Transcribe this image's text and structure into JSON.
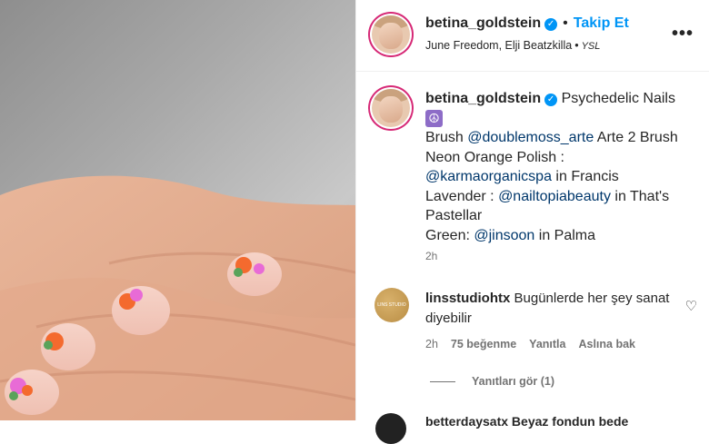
{
  "header": {
    "username": "betina_goldstein",
    "follow_label": "Takip Et",
    "audio": "June Freedom, Elji Beatzkilla",
    "brand": "YSL",
    "more_icon": "more-horizontal-icon"
  },
  "caption": {
    "username": "betina_goldstein",
    "title": "Psychedelic Nails",
    "emoji_icon": "peace-symbol-icon",
    "line1_a": "Brush ",
    "line1_mention": "@doublemoss_arte",
    "line1_b": " Arte 2 Brush",
    "line2": "Neon Orange Polish :",
    "line3_mention": "@karmaorganicspa",
    "line3_b": " in Francis",
    "line4_a": "Lavender : ",
    "line4_mention": "@nailtopiabeauty",
    "line4_b": " in That's",
    "line5": "Pastellar",
    "line6_a": "Green: ",
    "line6_mention": "@jinsoon",
    "line6_b": " in Palma",
    "time": "2h"
  },
  "comment": {
    "avatar_text": "LINS STUDIO",
    "username": "linsstudiohtx",
    "text": "Bugünlerde her şey sanat diyebilir",
    "time": "2h",
    "likes": "75 beğenme",
    "reply": "Yanıtla",
    "translate": "Aslına bak",
    "view_replies": "Yanıtları gör (1)"
  },
  "next_comment": {
    "text": "betterdaysatx Beyaz fondun bede"
  },
  "colors": {
    "accent": "#0095f6",
    "mention": "#00376b",
    "muted": "#737373"
  }
}
